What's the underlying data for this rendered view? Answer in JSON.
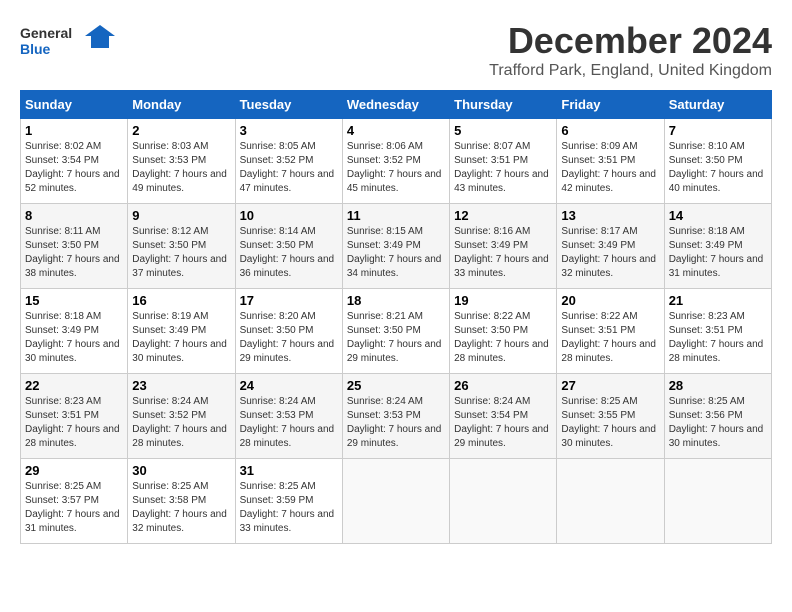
{
  "logo": {
    "line1": "General",
    "line2": "Blue"
  },
  "title": "December 2024",
  "location": "Trafford Park, England, United Kingdom",
  "days_of_week": [
    "Sunday",
    "Monday",
    "Tuesday",
    "Wednesday",
    "Thursday",
    "Friday",
    "Saturday"
  ],
  "weeks": [
    [
      {
        "day": "1",
        "sunrise": "8:02 AM",
        "sunset": "3:54 PM",
        "daylight": "7 hours and 52 minutes."
      },
      {
        "day": "2",
        "sunrise": "8:03 AM",
        "sunset": "3:53 PM",
        "daylight": "7 hours and 49 minutes."
      },
      {
        "day": "3",
        "sunrise": "8:05 AM",
        "sunset": "3:52 PM",
        "daylight": "7 hours and 47 minutes."
      },
      {
        "day": "4",
        "sunrise": "8:06 AM",
        "sunset": "3:52 PM",
        "daylight": "7 hours and 45 minutes."
      },
      {
        "day": "5",
        "sunrise": "8:07 AM",
        "sunset": "3:51 PM",
        "daylight": "7 hours and 43 minutes."
      },
      {
        "day": "6",
        "sunrise": "8:09 AM",
        "sunset": "3:51 PM",
        "daylight": "7 hours and 42 minutes."
      },
      {
        "day": "7",
        "sunrise": "8:10 AM",
        "sunset": "3:50 PM",
        "daylight": "7 hours and 40 minutes."
      }
    ],
    [
      {
        "day": "8",
        "sunrise": "8:11 AM",
        "sunset": "3:50 PM",
        "daylight": "7 hours and 38 minutes."
      },
      {
        "day": "9",
        "sunrise": "8:12 AM",
        "sunset": "3:50 PM",
        "daylight": "7 hours and 37 minutes."
      },
      {
        "day": "10",
        "sunrise": "8:14 AM",
        "sunset": "3:50 PM",
        "daylight": "7 hours and 36 minutes."
      },
      {
        "day": "11",
        "sunrise": "8:15 AM",
        "sunset": "3:49 PM",
        "daylight": "7 hours and 34 minutes."
      },
      {
        "day": "12",
        "sunrise": "8:16 AM",
        "sunset": "3:49 PM",
        "daylight": "7 hours and 33 minutes."
      },
      {
        "day": "13",
        "sunrise": "8:17 AM",
        "sunset": "3:49 PM",
        "daylight": "7 hours and 32 minutes."
      },
      {
        "day": "14",
        "sunrise": "8:18 AM",
        "sunset": "3:49 PM",
        "daylight": "7 hours and 31 minutes."
      }
    ],
    [
      {
        "day": "15",
        "sunrise": "8:18 AM",
        "sunset": "3:49 PM",
        "daylight": "7 hours and 30 minutes."
      },
      {
        "day": "16",
        "sunrise": "8:19 AM",
        "sunset": "3:49 PM",
        "daylight": "7 hours and 30 minutes."
      },
      {
        "day": "17",
        "sunrise": "8:20 AM",
        "sunset": "3:50 PM",
        "daylight": "7 hours and 29 minutes."
      },
      {
        "day": "18",
        "sunrise": "8:21 AM",
        "sunset": "3:50 PM",
        "daylight": "7 hours and 29 minutes."
      },
      {
        "day": "19",
        "sunrise": "8:22 AM",
        "sunset": "3:50 PM",
        "daylight": "7 hours and 28 minutes."
      },
      {
        "day": "20",
        "sunrise": "8:22 AM",
        "sunset": "3:51 PM",
        "daylight": "7 hours and 28 minutes."
      },
      {
        "day": "21",
        "sunrise": "8:23 AM",
        "sunset": "3:51 PM",
        "daylight": "7 hours and 28 minutes."
      }
    ],
    [
      {
        "day": "22",
        "sunrise": "8:23 AM",
        "sunset": "3:51 PM",
        "daylight": "7 hours and 28 minutes."
      },
      {
        "day": "23",
        "sunrise": "8:24 AM",
        "sunset": "3:52 PM",
        "daylight": "7 hours and 28 minutes."
      },
      {
        "day": "24",
        "sunrise": "8:24 AM",
        "sunset": "3:53 PM",
        "daylight": "7 hours and 28 minutes."
      },
      {
        "day": "25",
        "sunrise": "8:24 AM",
        "sunset": "3:53 PM",
        "daylight": "7 hours and 29 minutes."
      },
      {
        "day": "26",
        "sunrise": "8:24 AM",
        "sunset": "3:54 PM",
        "daylight": "7 hours and 29 minutes."
      },
      {
        "day": "27",
        "sunrise": "8:25 AM",
        "sunset": "3:55 PM",
        "daylight": "7 hours and 30 minutes."
      },
      {
        "day": "28",
        "sunrise": "8:25 AM",
        "sunset": "3:56 PM",
        "daylight": "7 hours and 30 minutes."
      }
    ],
    [
      {
        "day": "29",
        "sunrise": "8:25 AM",
        "sunset": "3:57 PM",
        "daylight": "7 hours and 31 minutes."
      },
      {
        "day": "30",
        "sunrise": "8:25 AM",
        "sunset": "3:58 PM",
        "daylight": "7 hours and 32 minutes."
      },
      {
        "day": "31",
        "sunrise": "8:25 AM",
        "sunset": "3:59 PM",
        "daylight": "7 hours and 33 minutes."
      },
      null,
      null,
      null,
      null
    ]
  ]
}
